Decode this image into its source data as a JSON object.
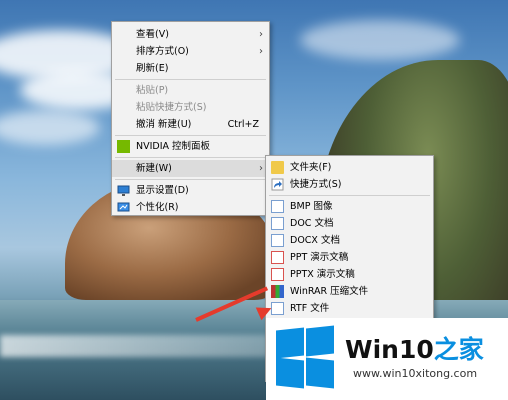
{
  "context_menu": {
    "items": [
      {
        "label": "查看(V)",
        "submenu": true
      },
      {
        "label": "排序方式(O)",
        "submenu": true
      },
      {
        "label": "刷新(E)"
      },
      {
        "label": "粘贴(P)",
        "disabled": true
      },
      {
        "label": "粘贴快捷方式(S)",
        "disabled": true
      },
      {
        "label": "撤消 新建(U)",
        "shortcut": "Ctrl+Z"
      },
      {
        "label": "NVIDIA 控制面板",
        "icon": "nvidia-icon"
      },
      {
        "label": "新建(W)",
        "submenu": true,
        "highlighted": true
      },
      {
        "label": "显示设置(D)",
        "icon": "display-icon"
      },
      {
        "label": "个性化(R)",
        "icon": "personalize-icon"
      }
    ]
  },
  "new_submenu": {
    "items": [
      {
        "label": "文件夹(F)",
        "icon": "folder-icon"
      },
      {
        "label": "快捷方式(S)",
        "icon": "shortcut-icon"
      },
      {
        "label": "BMP 图像",
        "icon": "bmp-icon"
      },
      {
        "label": "DOC 文档",
        "icon": "doc-icon"
      },
      {
        "label": "DOCX 文档",
        "icon": "docx-icon"
      },
      {
        "label": "PPT 演示文稿",
        "icon": "ppt-icon"
      },
      {
        "label": "PPTX 演示文稿",
        "icon": "pptx-icon"
      },
      {
        "label": "WinRAR 压缩文件",
        "icon": "winrar-icon"
      },
      {
        "label": "RTF 文件",
        "icon": "rtf-icon"
      }
    ]
  },
  "watermark": {
    "title_a": "Win10",
    "title_b": "之家",
    "url": "www.win10xitong.com",
    "brand_color": "#0a8fe0"
  }
}
